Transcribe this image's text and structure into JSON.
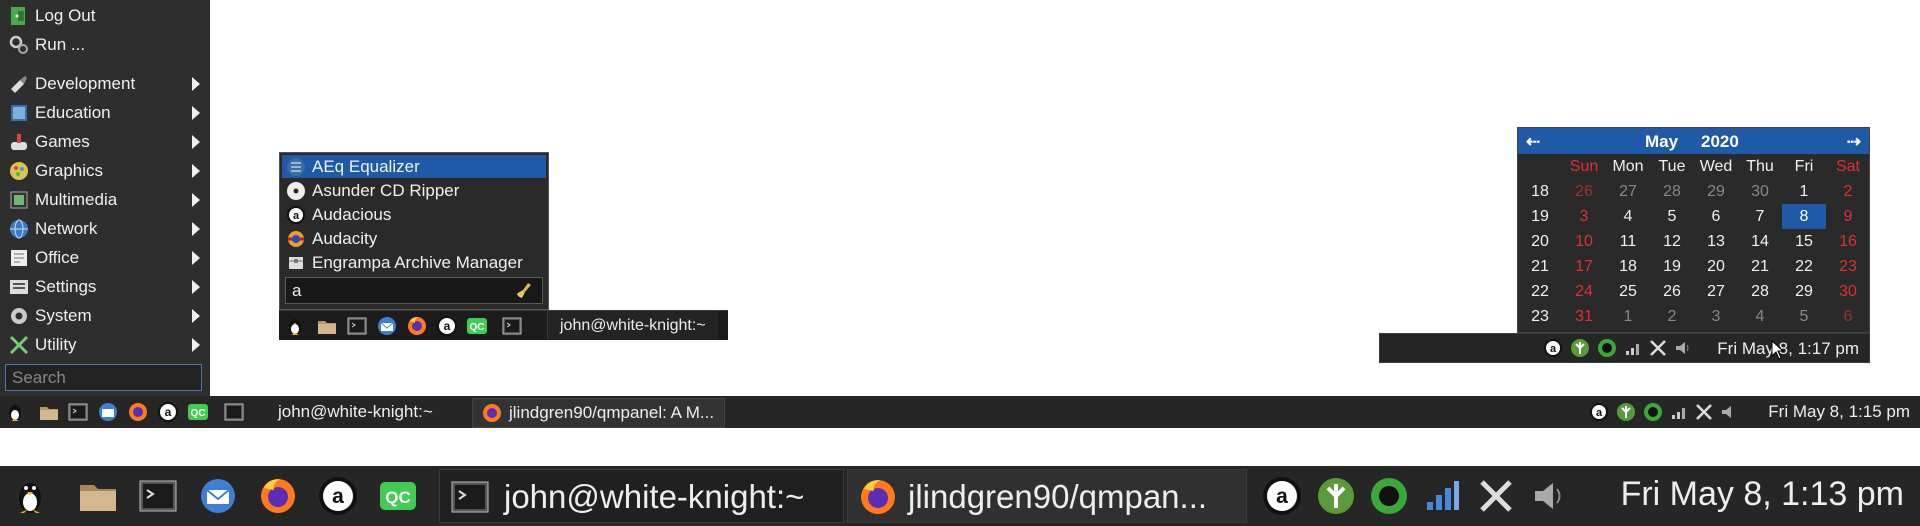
{
  "app_menu": {
    "items": [
      {
        "label": "Log Out",
        "icon": "logout-icon",
        "submenu": false
      },
      {
        "label": "Run ...",
        "icon": "run-icon",
        "submenu": false
      },
      {
        "label": "Development",
        "icon": "development-icon",
        "submenu": true
      },
      {
        "label": "Education",
        "icon": "education-icon",
        "submenu": true
      },
      {
        "label": "Games",
        "icon": "games-icon",
        "submenu": true
      },
      {
        "label": "Graphics",
        "icon": "graphics-icon",
        "submenu": true
      },
      {
        "label": "Multimedia",
        "icon": "multimedia-icon",
        "submenu": true
      },
      {
        "label": "Network",
        "icon": "network-icon",
        "submenu": true
      },
      {
        "label": "Office",
        "icon": "office-icon",
        "submenu": true
      },
      {
        "label": "Settings",
        "icon": "settings-icon",
        "submenu": true
      },
      {
        "label": "System",
        "icon": "system-icon",
        "submenu": true
      },
      {
        "label": "Utility",
        "icon": "utility-icon",
        "submenu": true
      }
    ],
    "search_placeholder": "Search"
  },
  "launcher": {
    "results": [
      {
        "label": "AEq Equalizer",
        "icon": "aeq-icon",
        "selected": true
      },
      {
        "label": "Asunder CD Ripper",
        "icon": "cd-ripper-icon",
        "selected": false
      },
      {
        "label": "Audacious",
        "icon": "audacious-icon",
        "selected": false
      },
      {
        "label": "Audacity",
        "icon": "audacity-icon",
        "selected": false
      },
      {
        "label": "Engrampa Archive Manager",
        "icon": "archive-icon",
        "selected": false
      }
    ],
    "query": "a"
  },
  "mini_panel": {
    "task_label": "john@white-knight:~"
  },
  "calendar": {
    "month": "May",
    "year": "2020",
    "weekdays": [
      "Sun",
      "Mon",
      "Tue",
      "Wed",
      "Thu",
      "Fri",
      "Sat"
    ],
    "weeks": [
      {
        "week": "18",
        "days": [
          "26",
          "27",
          "28",
          "29",
          "30",
          "1",
          "2"
        ]
      },
      {
        "week": "19",
        "days": [
          "3",
          "4",
          "5",
          "6",
          "7",
          "8",
          "9"
        ]
      },
      {
        "week": "20",
        "days": [
          "10",
          "11",
          "12",
          "13",
          "14",
          "15",
          "16"
        ]
      },
      {
        "week": "21",
        "days": [
          "17",
          "18",
          "19",
          "20",
          "21",
          "22",
          "23"
        ]
      },
      {
        "week": "22",
        "days": [
          "24",
          "25",
          "26",
          "27",
          "28",
          "29",
          "30"
        ]
      },
      {
        "week": "23",
        "days": [
          "31",
          "1",
          "2",
          "3",
          "4",
          "5",
          "6"
        ]
      }
    ],
    "today": "8",
    "weekend_color": "#e03030",
    "accent": "#1f5aa8"
  },
  "mini_tray": {
    "clock": "Fri May 8, 1:17 pm"
  },
  "mid_taskbar": {
    "tasks": [
      "john@white-knight:~",
      "jlindgren90/qmpanel: A M..."
    ],
    "clock": "Fri May 8, 1:15 pm"
  },
  "big_taskbar": {
    "tasks": [
      "john@white-knight:~",
      "jlindgren90/qmpan..."
    ],
    "clock": "Fri May 8, 1:13 pm"
  }
}
